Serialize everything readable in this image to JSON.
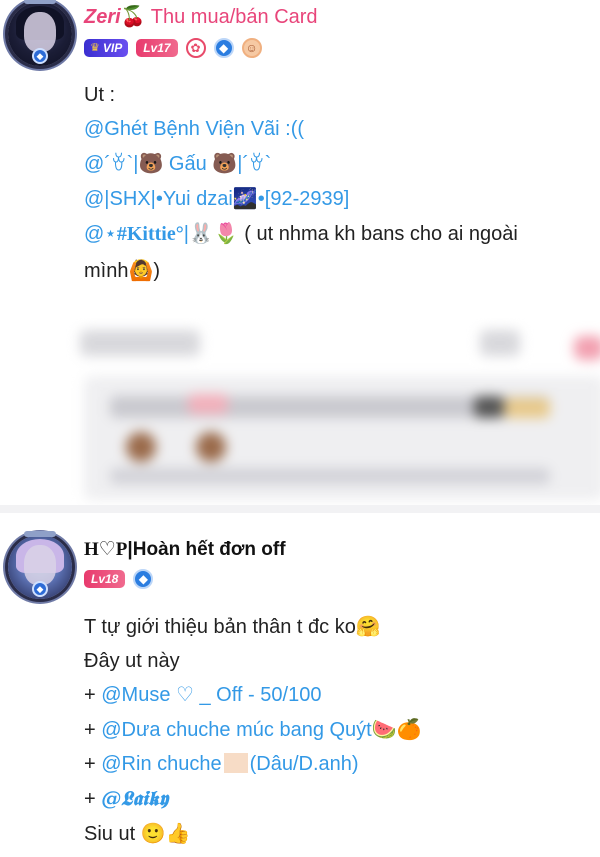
{
  "post1": {
    "username": "Zeri",
    "name_emoji": "🍒",
    "name_suffix": " Thu mua/bán Card",
    "vip_label": "VIP",
    "level": "Lv17",
    "lines": {
      "l1": "Ut :",
      "l2": "@Ghét Bệnh Viện Vãi :((",
      "l3_a": "@´ꈊ`|",
      "l3_bear": "🐻",
      "l3_b": " Gấu ",
      "l3_bear2": "🐻",
      "l3_c": "|´ꈊ`",
      "l4_a": "@|SHX|•Yui dzai",
      "l4_emoji": "🌌",
      "l4_b": "•[92-2939]",
      "l5_a": "@⋆",
      "l5_kittie": "#Kittie°",
      "l5_b": "|",
      "l5_emoji": "🐰🌷",
      "l5_c": " ( ut nhma kh bans cho ai ngoài",
      "l6_a": "mình",
      "l6_emoji": "🙆",
      "l6_b": ")"
    }
  },
  "post2": {
    "username_a": "H♡P",
    "username_b": "|Hoàn hết đơn off",
    "level": "Lv18",
    "lines": {
      "l1_a": "T tự giới thiệu bản thân t đc ko",
      "l1_emoji": "🤗",
      "l2": "Đây ut này",
      "l3_plus": "+ ",
      "l3": "@Muse ♡ _ Off - 50/100",
      "l4_plus": "+ ",
      "l4": "@Dưa chuche múc bang Quýt",
      "l4_emoji": "🍉🍊",
      "l5_plus": "+ ",
      "l5_a": "@Rin chuche",
      "l5_b": "(Dâu/D.anh)",
      "l6_plus": "+ ",
      "l6": "@𝕷𝖆𝖎𝖐𝖞",
      "l7": "Siu ut ",
      "l7_emoji": "🙂👍"
    }
  },
  "colors": {
    "accent_pink": "#e8457a",
    "mention_blue": "#3399e6",
    "vip_purple": "#3a2fd0",
    "level_red": "#e83a6d"
  },
  "icons": [
    "crown-icon",
    "bunny-badge-icon",
    "diamond-badge-icon",
    "face-badge-icon",
    "avatar-frame-icon"
  ]
}
